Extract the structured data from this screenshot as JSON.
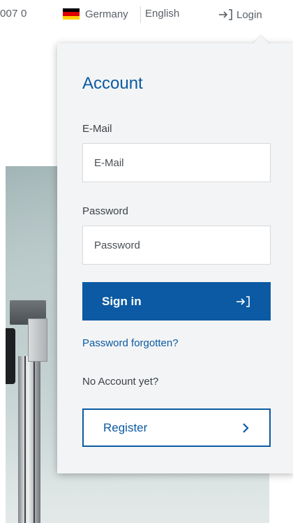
{
  "header": {
    "phone_fragment": "007 0",
    "country_label": "Germany",
    "flag_colors": [
      "#000000",
      "#dd0000",
      "#ffce00"
    ],
    "language_label": "English",
    "login_label": "Login",
    "login_icon": "login-arrow-icon"
  },
  "login_panel": {
    "title": "Account",
    "email_label": "E-Mail",
    "email_placeholder": "E-Mail",
    "email_value": "",
    "password_label": "Password",
    "password_placeholder": "Password",
    "password_value": "",
    "signin_label": "Sign in",
    "signin_icon": "login-arrow-icon",
    "forgot_link": "Password forgotten?",
    "no_account_text": "No Account yet?",
    "register_label": "Register",
    "register_icon": "chevron-right-icon"
  },
  "colors": {
    "brand_blue": "#0b5aa3",
    "panel_bg": "#f3f4f5",
    "text_gray": "#5a6068"
  }
}
